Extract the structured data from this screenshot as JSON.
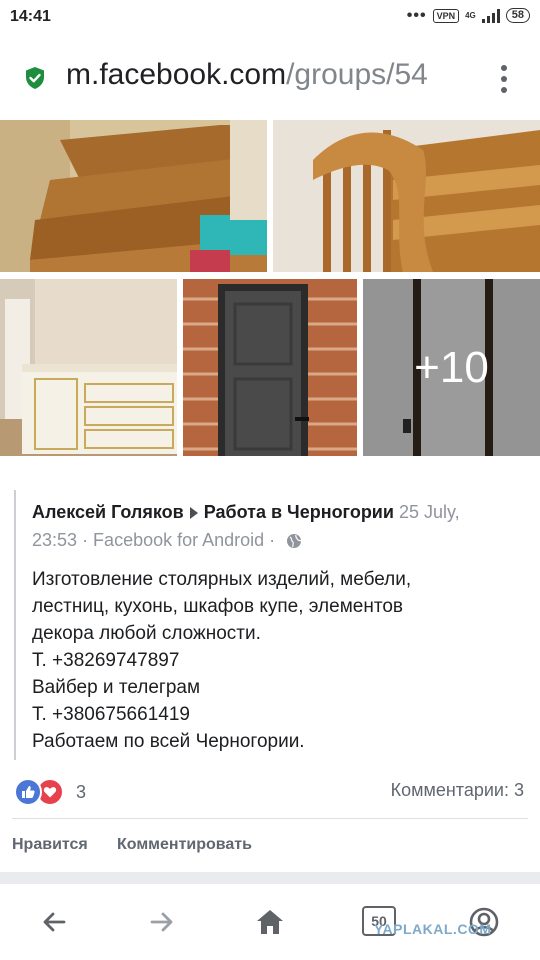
{
  "status_bar": {
    "time": "14:41",
    "vpn": "VPN",
    "network": "4G",
    "battery": "58"
  },
  "browser": {
    "url_host": "m.facebook.com",
    "url_path": "/groups/54"
  },
  "gallery": {
    "more_count": "+10"
  },
  "post": {
    "author": "Алексей Голяков",
    "group": "Работа в Черногории",
    "date": "25 July,",
    "time": "23:53",
    "source": "· Facebook for Android ·",
    "lines": [
      "Изготовление столярных изделий, мебели,",
      "лестниц, кухонь, шкафов купе, элементов",
      "декора любой сложности.",
      "Т. +38269747897",
      "Вайбер и телеграм",
      "Т. +380675661419",
      "Работаем по всей Черногории."
    ],
    "reaction_count": "3",
    "comments_label": "Комментарии: 3"
  },
  "actions": {
    "like": "Нравится",
    "comment": "Комментировать"
  },
  "nav": {
    "tabs": "50",
    "watermark": "YAPLAKAL.COM"
  },
  "colors": {
    "facebook_blue": "#4a76d6",
    "love_red": "#e8414e",
    "secure_green": "#1e8e3e"
  }
}
